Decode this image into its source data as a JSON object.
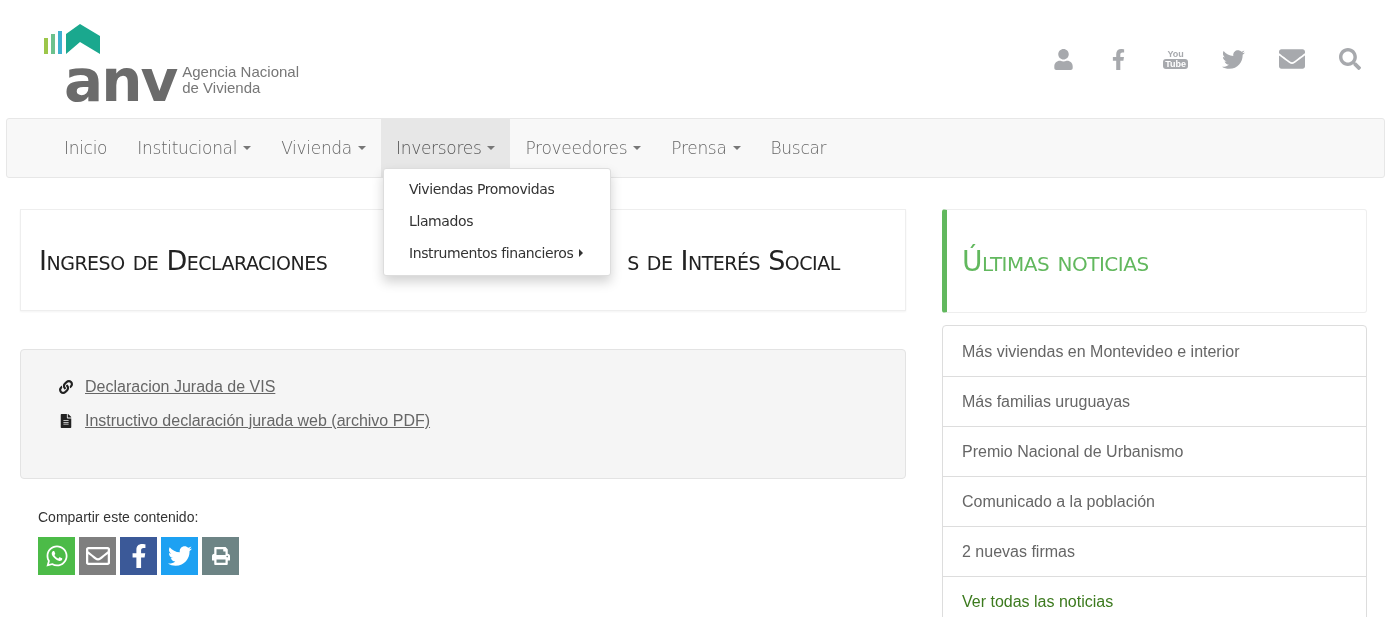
{
  "logo": {
    "mark": "anv",
    "name_line1": "Agencia Nacional",
    "name_line2": "de Vivienda"
  },
  "header_icons": [
    {
      "kind": "user"
    },
    {
      "kind": "facebook"
    },
    {
      "kind": "youtube",
      "top": "You",
      "bottom": "Tube"
    },
    {
      "kind": "twitter"
    },
    {
      "kind": "mail"
    },
    {
      "kind": "search"
    }
  ],
  "nav": [
    {
      "label": "Inicio",
      "has_caret": false,
      "selected": false
    },
    {
      "label": "Institucional",
      "has_caret": true,
      "selected": false
    },
    {
      "label": "Vivienda",
      "has_caret": true,
      "selected": false
    },
    {
      "label": "Inversores",
      "has_caret": true,
      "selected": true
    },
    {
      "label": "Proveedores",
      "has_caret": true,
      "selected": false
    },
    {
      "label": "Prensa",
      "has_caret": true,
      "selected": false
    },
    {
      "label": "Buscar",
      "has_caret": false,
      "selected": false
    }
  ],
  "dropdown": [
    {
      "label": "Viviendas Promovidas",
      "has_submenu": false
    },
    {
      "label": "Llamados",
      "has_submenu": false
    },
    {
      "label": "Instrumentos financieros",
      "has_submenu": true
    }
  ],
  "page_title": {
    "visible_start": "Ingreso de Declaraciones",
    "visible_end": "s de Interés Social"
  },
  "links": [
    {
      "kind": "link",
      "label": "Declaracion Jurada de VIS"
    },
    {
      "kind": "file",
      "label": "Instructivo declaración jurada web (archivo PDF)"
    }
  ],
  "share": {
    "label": "Compartir este contenido:",
    "buttons": [
      {
        "kind": "whatsapp",
        "color": "#4cbb48"
      },
      {
        "kind": "email",
        "color": "#7f7f7f"
      },
      {
        "kind": "facebook",
        "color": "#3b5998"
      },
      {
        "kind": "twitter",
        "color": "#1da1f2"
      },
      {
        "kind": "print",
        "color": "#6d8485"
      }
    ]
  },
  "news": {
    "title": "Últimas noticias",
    "items": [
      {
        "label": "Más viviendas en Montevideo e interior",
        "kind": "news"
      },
      {
        "label": "Más familias uruguayas",
        "kind": "news"
      },
      {
        "label": "Premio Nacional de Urbanismo",
        "kind": "news"
      },
      {
        "label": "Comunicado a la población",
        "kind": "news"
      },
      {
        "label": "2 nuevas firmas",
        "kind": "news"
      },
      {
        "label": "Ver todas las noticias",
        "kind": "more"
      }
    ]
  }
}
